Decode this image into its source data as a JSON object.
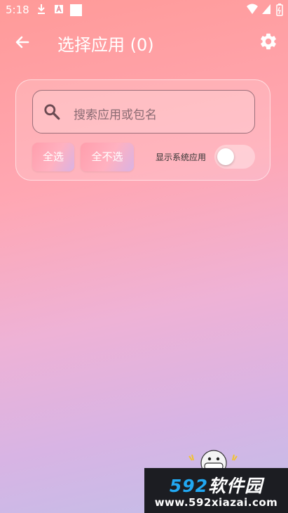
{
  "status_bar": {
    "time": "5:18",
    "icons": [
      "download-icon",
      "a-icon",
      "square-icon",
      "wifi-icon",
      "signal-icon",
      "battery-icon"
    ]
  },
  "app_bar": {
    "title": "选择应用 (0)",
    "back_icon": "arrow-back-icon",
    "settings_icon": "gear-icon"
  },
  "search": {
    "placeholder": "搜索应用或包名"
  },
  "actions": {
    "select_all": "全选",
    "select_none": "全不选",
    "show_system_label": "显示系统应用",
    "show_system_on": false
  },
  "watermark": {
    "brand_number": "592",
    "brand_text": "软件园",
    "url": "www.592xiazai.com"
  },
  "colors": {
    "bg_top": "#ff9a98",
    "bg_bottom": "#c2bee8",
    "watermark_bg": "#1c1d22",
    "watermark_accent": "#21a8f2"
  }
}
